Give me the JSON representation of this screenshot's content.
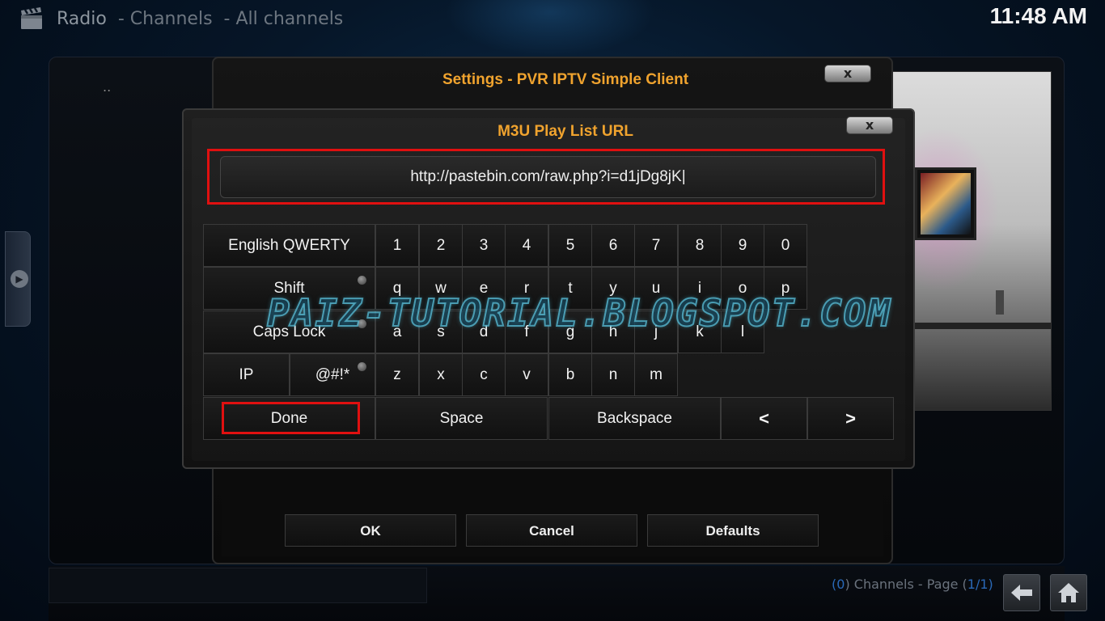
{
  "header": {
    "breadcrumb": [
      "Radio",
      "- Channels",
      "- All channels"
    ],
    "clock": "11:48 AM"
  },
  "background": {
    "list_item": ".."
  },
  "settings_dialog": {
    "title": "Settings - PVR IPTV Simple Client",
    "close_label": "x",
    "buttons": {
      "ok": "OK",
      "cancel": "Cancel",
      "defaults": "Defaults"
    }
  },
  "keyboard_dialog": {
    "title": "M3U Play List URL",
    "close_label": "x",
    "input_value": "http://pastebin.com/raw.php?i=d1jDg8jK|",
    "layout_label": "English QWERTY",
    "digits": [
      "1",
      "2",
      "3",
      "4",
      "5",
      "6",
      "7",
      "8",
      "9",
      "0"
    ],
    "row_q": [
      "q",
      "w",
      "e",
      "r",
      "t",
      "y",
      "u",
      "i",
      "o",
      "p"
    ],
    "row_a": [
      "a",
      "s",
      "d",
      "f",
      "g",
      "h",
      "j",
      "k",
      "l"
    ],
    "row_z": [
      "z",
      "x",
      "c",
      "v",
      "b",
      "n",
      "m"
    ],
    "modifiers": {
      "shift": "Shift",
      "caps": "Caps Lock",
      "ip": "IP",
      "symbols": "@#!*"
    },
    "actions": {
      "done": "Done",
      "space": "Space",
      "backspace": "Backspace",
      "left": "<",
      "right": ">"
    }
  },
  "footer": {
    "status_parts": [
      "(",
      "0",
      ") Channels - Page (",
      "1/1",
      ")"
    ]
  },
  "watermark": "PAIZ-TUTORIAL.BLOGSPOT.COM"
}
